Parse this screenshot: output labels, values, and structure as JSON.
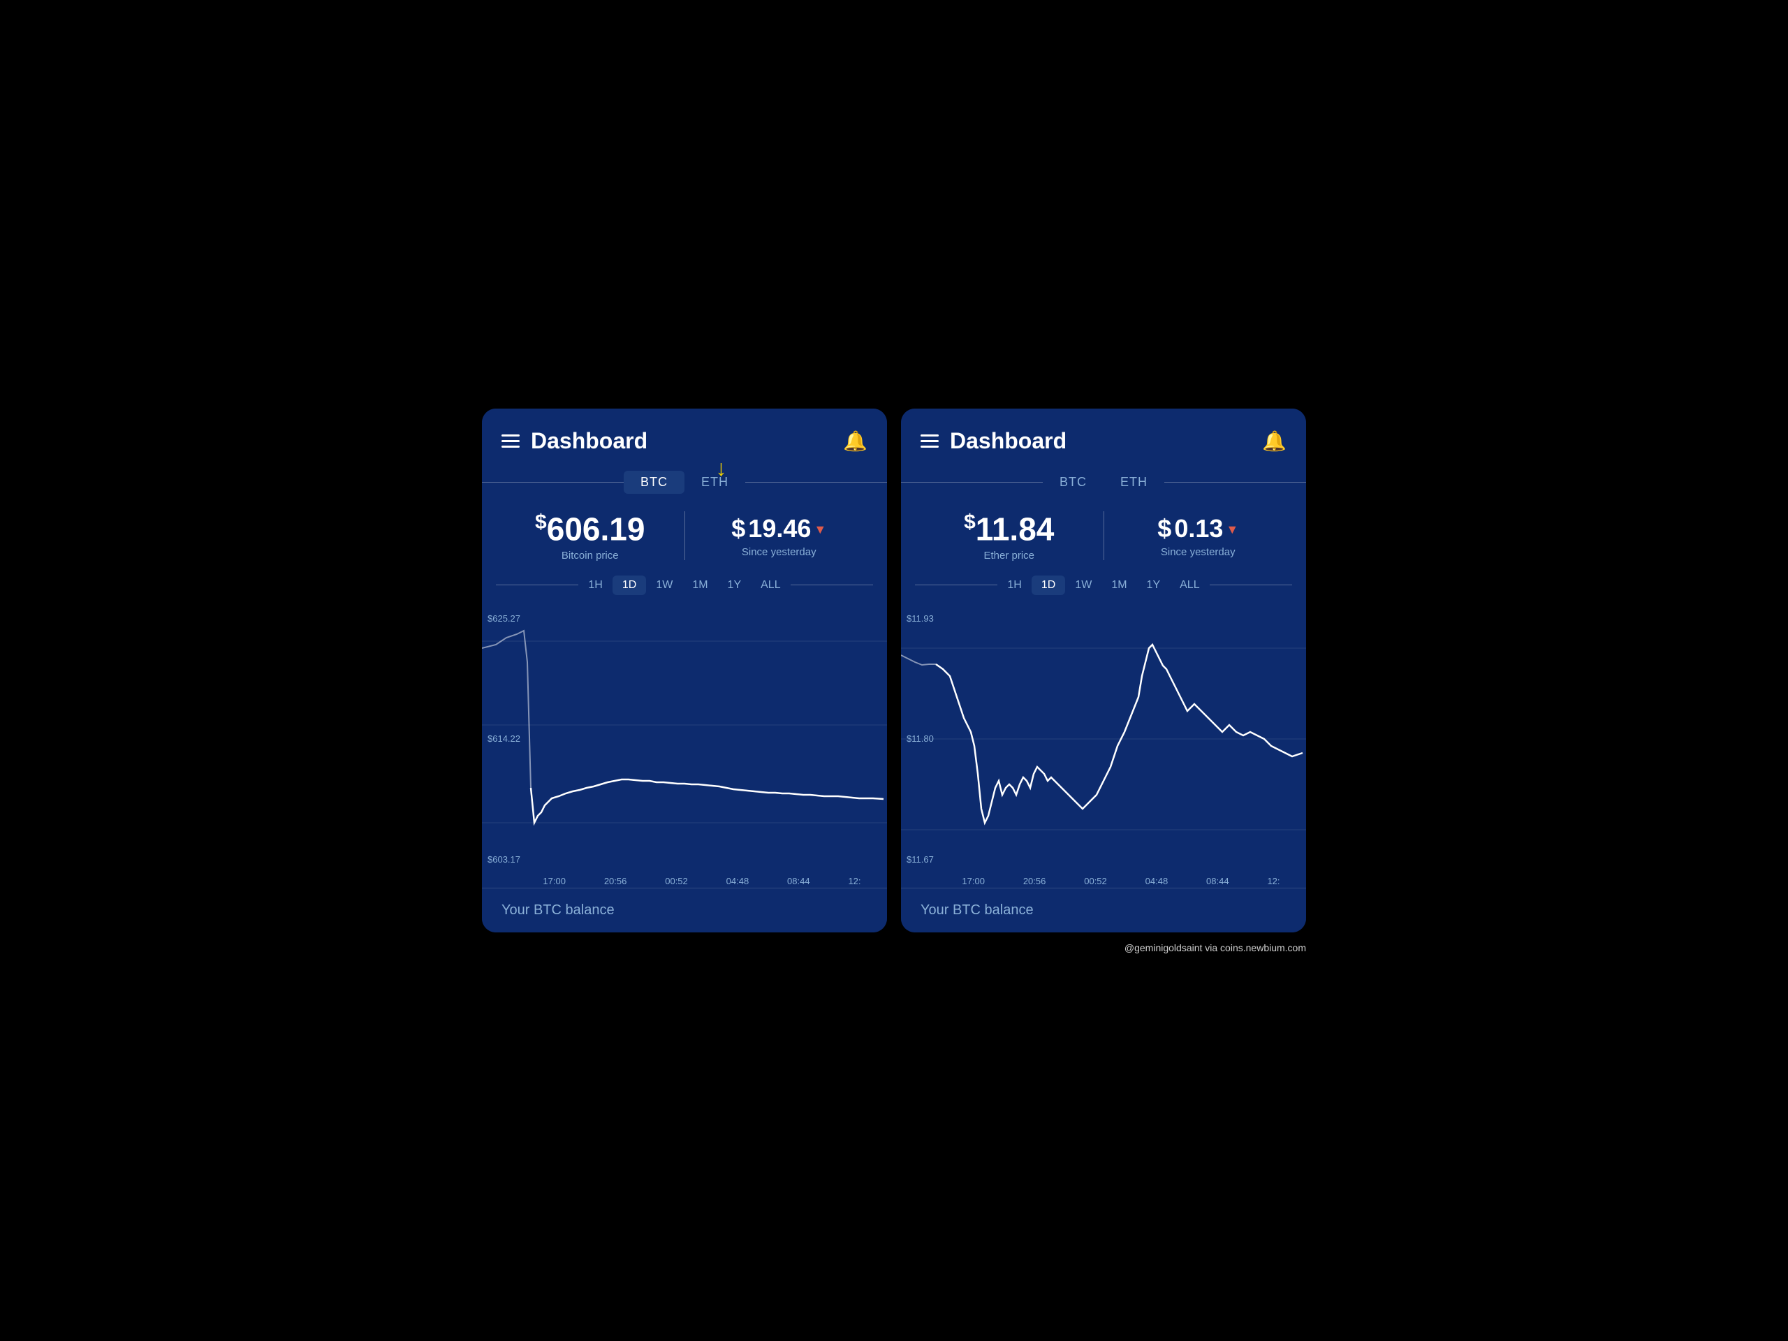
{
  "left_panel": {
    "title": "Dashboard",
    "tabs": [
      {
        "label": "BTC",
        "active": true
      },
      {
        "label": "ETH",
        "active": false
      }
    ],
    "price_main": "606.19",
    "price_main_label": "Bitcoin price",
    "price_change": "19.46",
    "price_change_label": "Since yesterday",
    "timeframes": [
      "1H",
      "1D",
      "1W",
      "1M",
      "1Y",
      "ALL"
    ],
    "active_timeframe": "1D",
    "chart_labels_y": [
      "$625.27",
      "$614.22",
      "$603.17"
    ],
    "chart_labels_x": [
      "17:00",
      "20:56",
      "00:52",
      "04:48",
      "08:44",
      "12:"
    ],
    "balance_label": "Your BTC balance",
    "arrow_indicator": "↓"
  },
  "right_panel": {
    "title": "Dashboard",
    "tabs": [
      {
        "label": "BTC",
        "active": false
      },
      {
        "label": "ETH",
        "active": false
      }
    ],
    "price_main": "11.84",
    "price_main_label": "Ether price",
    "price_change": "0.13",
    "price_change_label": "Since yesterday",
    "timeframes": [
      "1H",
      "1D",
      "1W",
      "1M",
      "1Y",
      "ALL"
    ],
    "active_timeframe": "1D",
    "chart_labels_y": [
      "$11.93",
      "$11.80",
      "$11.67"
    ],
    "chart_labels_x": [
      "17:00",
      "20:56",
      "00:52",
      "04:48",
      "08:44",
      "12:"
    ],
    "balance_label": "Your BTC balance"
  },
  "watermark": "@geminigoldsaint via coins.newbium.com",
  "icons": {
    "hamburger": "☰",
    "bell": "🔔",
    "arrow_down": "▼"
  }
}
